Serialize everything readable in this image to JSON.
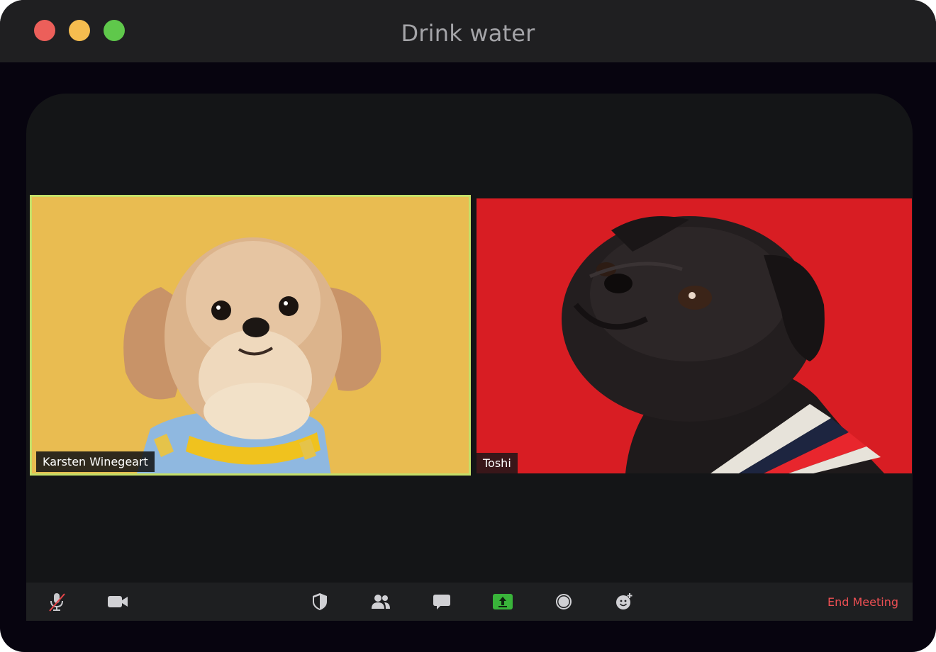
{
  "window": {
    "title": "Drink water",
    "controls": [
      "close",
      "minimize",
      "maximize"
    ]
  },
  "participants": [
    {
      "name": "Karsten Winegeart",
      "background_color": "#e9bc51",
      "active_speaker": true,
      "highlight_color": "#c5df68"
    },
    {
      "name": "Toshi",
      "background_color": "#d81d23",
      "active_speaker": false
    }
  ],
  "toolbar": {
    "left_tools": [
      {
        "icon": "microphone-muted-icon"
      },
      {
        "icon": "video-camera-icon"
      }
    ],
    "center_tools": [
      {
        "icon": "shield-security-icon"
      },
      {
        "icon": "participants-icon"
      },
      {
        "icon": "chat-bubble-icon"
      },
      {
        "icon": "share-screen-icon",
        "color": "#39b43a"
      },
      {
        "icon": "record-icon"
      },
      {
        "icon": "reaction-icon"
      }
    ],
    "end_meeting_label": "End Meeting",
    "end_meeting_color": "#ec4f53"
  }
}
